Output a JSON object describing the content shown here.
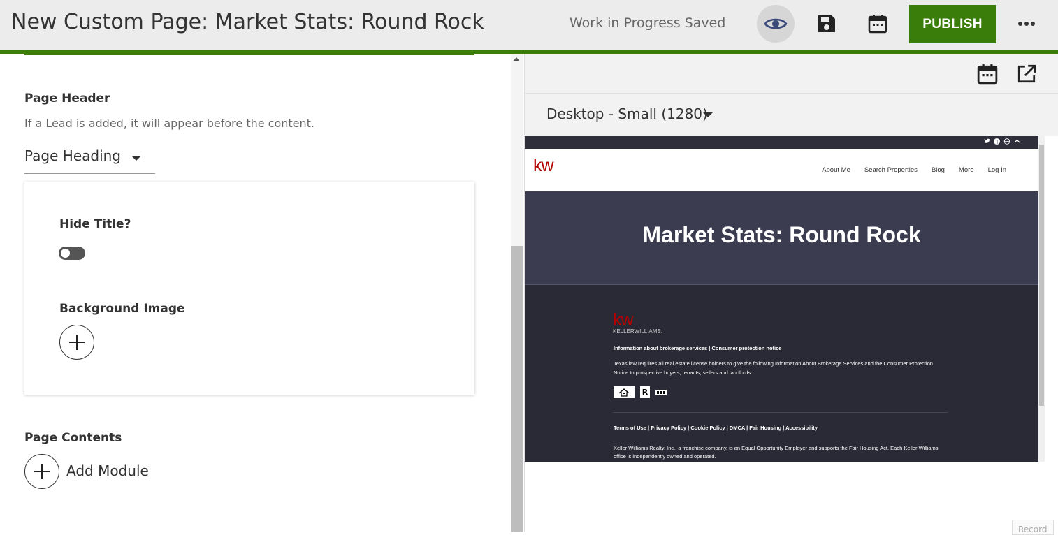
{
  "header": {
    "title": "New Custom Page: Market Stats: Round Rock",
    "status": "Work in Progress Saved",
    "publish_label": "PUBLISH"
  },
  "left": {
    "page_header": {
      "title": "Page Header",
      "description": "If a Lead is added, it will appear before the content.",
      "select_value": "Page Heading"
    },
    "card": {
      "hide_title_label": "Hide Title?",
      "hide_title_on": false,
      "background_image_label": "Background Image"
    },
    "page_contents": {
      "title": "Page Contents",
      "add_module_label": "Add Module"
    }
  },
  "right": {
    "device_select": "Desktop - Small (1280)",
    "cut_button_label": "Record"
  },
  "preview": {
    "logo": "kw",
    "nav_links": [
      "About Me",
      "Search Properties",
      "Blog",
      "More",
      "Log In"
    ],
    "hero_title": "Market Stats: Round Rock",
    "footer": {
      "brand": "KELLERWILLIAMS.",
      "links_line": "Information about brokerage services  |  Consumer protection notice",
      "notice_line1": "Texas law requires all real estate license holders to give the following Information About Brokerage Services and the Consumer Protection",
      "notice_line2": "Notice to prospective buyers, tenants, sellers and landlords.",
      "legal_links": "Terms of Use | Privacy Policy | Cookie Policy | DMCA | Fair Housing | Accessibility",
      "disclaimer1": "Keller Williams Realty, Inc., a franchise company, is an Equal Opportunity Employer and supports the Fair Housing Act. Each Keller Williams",
      "disclaimer2": "office is independently owned and operated."
    }
  },
  "colors": {
    "brand_green": "#3a7d0a",
    "kw_red": "#b40101",
    "hero_bg": "#3c3c50",
    "footer_bg": "#2a2a36"
  }
}
